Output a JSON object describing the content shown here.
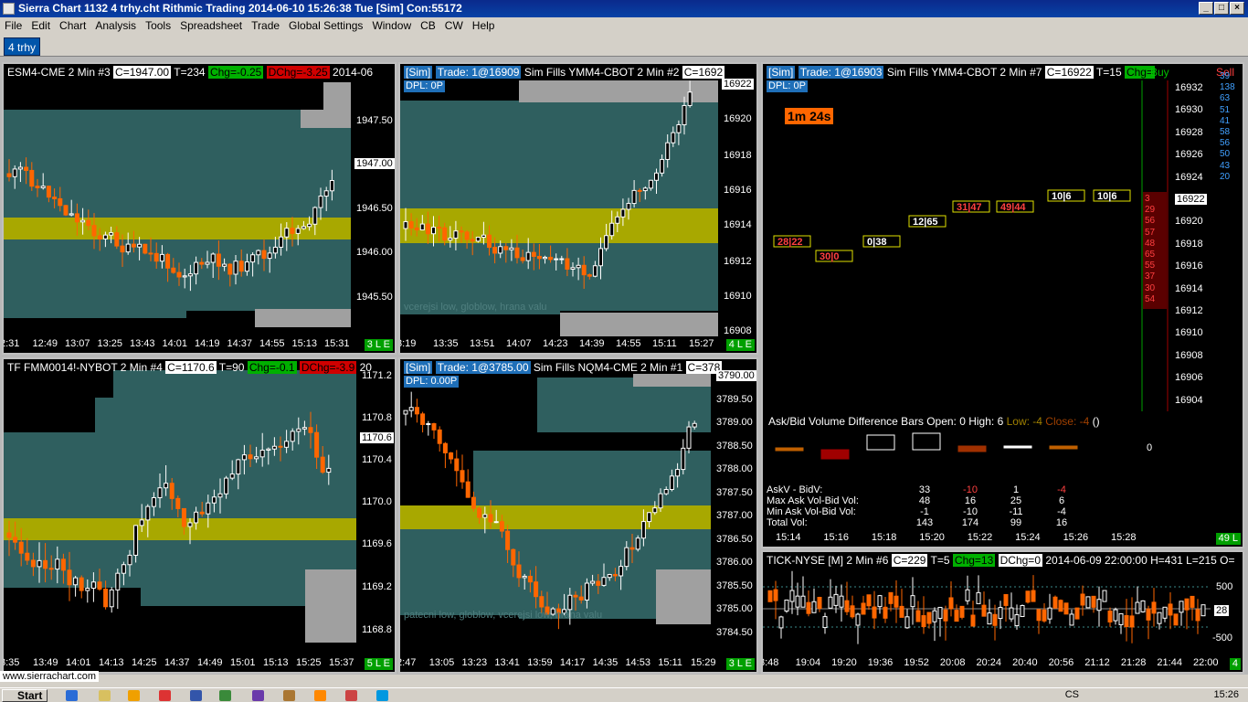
{
  "window": {
    "title": "Sierra Chart 1132 4 trhy.cht  Rithmic Trading 2014-06-10  15:26:38 Tue [Sim]  Con:55172"
  },
  "menu": [
    "File",
    "Edit",
    "Chart",
    "Analysis",
    "Tools",
    "Spreadsheet",
    "Trade",
    "Global Settings",
    "Window",
    "CB",
    "CW",
    "Help"
  ],
  "tabs": [
    {
      "label": "4 trhy"
    }
  ],
  "charts": {
    "es": {
      "symbol": "ESM4-CME  2 Min  #3",
      "close": "C=1947.00",
      "trades": "T=234",
      "chg": "Chg=-0.25",
      "dchg": "DChg=-3.25",
      "date": "2014-06",
      "prices": [
        "1947.50",
        "1947.00",
        "1946.50",
        "1946.00",
        "1945.50"
      ],
      "times": [
        "2:31",
        "12:49",
        "13:07",
        "13:25",
        "13:43",
        "14:01",
        "14:19",
        "14:37",
        "14:55",
        "15:13",
        "15:31"
      ],
      "badge": "3 L E"
    },
    "ym": {
      "sim": "[Sim]",
      "trade": "Trade: 1@16909",
      "title": "Sim Fills  YMM4-CBOT  2 Min  #2",
      "close": "C=1692",
      "dpl": "DPL: 0P",
      "prices": [
        "16922",
        "16920",
        "16918",
        "16916",
        "16914",
        "16912",
        "16910",
        "16908"
      ],
      "times": [
        "3:19",
        "13:35",
        "13:51",
        "14:07",
        "14:23",
        "14:39",
        "14:55",
        "15:11",
        "15:27"
      ],
      "annotation": "vcerejsi low, globlow, hrana valu",
      "badge": "4 L E"
    },
    "ymfp": {
      "sim": "[Sim]",
      "trade": "Trade: 1@16903",
      "title": "Sim Fills  YMM4-CBOT  2 Min  #7",
      "close": "C=16922",
      "trades": "T=15",
      "chg": "Chg=",
      "buy": "Buy",
      "sell": "Sell",
      "dpl": "DPL: 0P",
      "timer": "1m 24s",
      "prices": [
        "16932",
        "16930",
        "16928",
        "16926",
        "16924",
        "16922",
        "16920",
        "16918",
        "16916",
        "16914",
        "16912",
        "16910",
        "16908",
        "16906",
        "16904"
      ],
      "buyvol": [
        "39",
        "138",
        "63",
        "51",
        "41",
        "58",
        "56",
        "50",
        "43",
        "20"
      ],
      "sellvol": [
        "3",
        "29",
        "56",
        "57",
        "48",
        "65",
        "55",
        "37",
        "30",
        "54"
      ],
      "ab_title": "Ask/Bid Volume Difference Bars  Open: 0  High: 6",
      "ab_low": "Low: -4",
      "ab_close": "Close: -4",
      "ab_paren": "()",
      "zero": "0",
      "stat_labels": [
        "AskV - BidV:",
        "Max Ask Vol-Bid Vol:",
        "Min Ask Vol-Bid Vol:",
        "Total Vol:"
      ],
      "stat_cols": [
        [
          "33",
          "48",
          "-1",
          "143"
        ],
        [
          "-10",
          "16",
          "-10",
          "174"
        ],
        [
          "1",
          "25",
          "-11",
          "99"
        ],
        [
          "-4",
          "6",
          "-4",
          "16"
        ]
      ],
      "times": [
        "15:14",
        "15:16",
        "15:18",
        "15:20",
        "15:22",
        "15:24",
        "15:26",
        "15:28"
      ],
      "badge": "49 L"
    },
    "tf": {
      "symbol": "TF  FMM0014!-NYBOT  2 Min  #4",
      "close": "C=1170.6",
      "trades": "T=90",
      "chg": "Chg=-0.1",
      "dchg": "DChg=-3.9",
      "extra": "20",
      "prices": [
        "1171.2",
        "1170.8",
        "1170.6",
        "1170.4",
        "1170.0",
        "1169.6",
        "1169.2",
        "1168.8"
      ],
      "times": [
        "3:35",
        "13:49",
        "14:01",
        "14:13",
        "14:25",
        "14:37",
        "14:49",
        "15:01",
        "15:13",
        "15:25",
        "15:37"
      ],
      "badge": "5 L E"
    },
    "nq": {
      "sim": "[Sim]",
      "trade": "Trade: 1@3785.00",
      "title": "Sim Fills  NQM4-CME  2 Min  #1",
      "close": "C=378",
      "dpl": "DPL: 0.00P",
      "prices": [
        "3790.00",
        "3789.50",
        "3789.00",
        "3788.50",
        "3788.00",
        "3787.50",
        "3787.00",
        "3786.50",
        "3786.00",
        "3785.50",
        "3785.00",
        "3784.50"
      ],
      "times": [
        "2:47",
        "13:05",
        "13:23",
        "13:41",
        "13:59",
        "14:17",
        "14:35",
        "14:53",
        "15:11",
        "15:29"
      ],
      "annotation": "patecni low, globlow, vcerejsi low, hrana valu",
      "badge": "3 L E"
    },
    "tick": {
      "symbol": "TICK-NYSE [M]  2 Min  #6",
      "close": "C=229",
      "trades": "T=5",
      "chg": "Chg=13",
      "dchg": "DChg=0",
      "info": "2014-06-09 22:00:00 H=431 L=215 O=",
      "prices": [
        "500",
        "28",
        "-500"
      ],
      "times": [
        "3:48",
        "19:04",
        "19:20",
        "19:36",
        "19:52",
        "20:08",
        "20:24",
        "20:40",
        "20:56",
        "21:12",
        "21:28",
        "21:44",
        "22:00"
      ],
      "badge": "4"
    }
  },
  "status": {
    "url": "www.sierrachart.com"
  },
  "taskbar": {
    "start": "Start",
    "lang": "CS",
    "clock": "15:26"
  },
  "colors": {
    "bg": "#000000",
    "profile": "#2f5f5f",
    "poc": "#a8a800",
    "up": "#ffffff",
    "down": "#ff6600",
    "gray": "#a0a0a0"
  }
}
